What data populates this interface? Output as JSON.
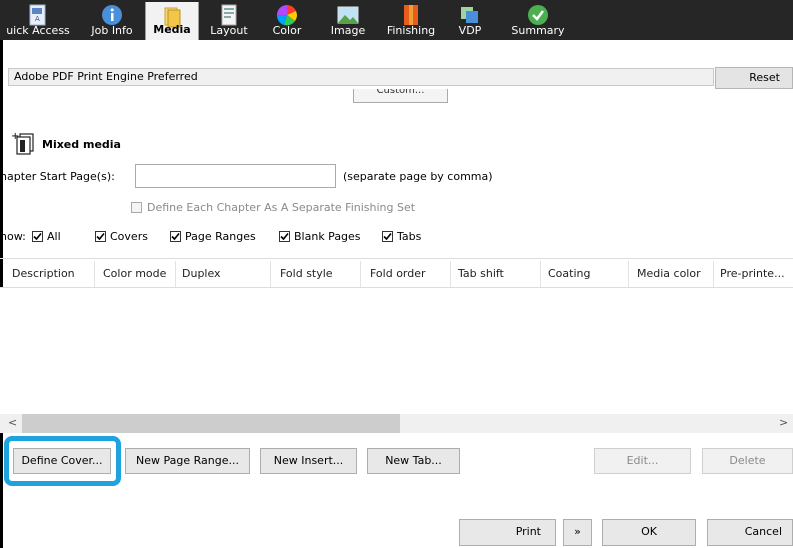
{
  "toolbar": {
    "tabs": [
      {
        "label": "uick Access",
        "icon": "quick-access-icon"
      },
      {
        "label": "Job Info",
        "icon": "info-icon"
      },
      {
        "label": "Media",
        "icon": "media-icon"
      },
      {
        "label": "Layout",
        "icon": "layout-icon"
      },
      {
        "label": "Color",
        "icon": "color-wheel-icon"
      },
      {
        "label": "Image",
        "icon": "image-icon"
      },
      {
        "label": "Finishing",
        "icon": "finishing-icon"
      },
      {
        "label": "VDP",
        "icon": "vdp-icon"
      },
      {
        "label": "Summary",
        "icon": "check-icon"
      }
    ],
    "active": "Media"
  },
  "engine": {
    "label": "Adobe PDF Print Engine Preferred",
    "reset_label": "Reset",
    "custom_label": "Custom..."
  },
  "mixed_media": {
    "title": "Mixed media",
    "chapter_label": "hapter Start Page(s):",
    "chapter_value": "",
    "chapter_hint": "(separate page by comma)",
    "define_chapter_label": "Define Each Chapter As A Separate Finishing Set",
    "show_label": "how:",
    "show_options": [
      {
        "label": "All",
        "checked": true
      },
      {
        "label": "Covers",
        "checked": true
      },
      {
        "label": "Page Ranges",
        "checked": true
      },
      {
        "label": "Blank Pages",
        "checked": true
      },
      {
        "label": "Tabs",
        "checked": true
      }
    ]
  },
  "table": {
    "columns": [
      "Description",
      "Color mode",
      "Duplex",
      "Fold style",
      "Fold order",
      "Tab shift",
      "Coating",
      "Media color",
      "Pre-printe..."
    ],
    "rows": []
  },
  "buttons": {
    "define_cover": "Define Cover...",
    "new_page_range": "New Page Range...",
    "new_insert": "New Insert...",
    "new_tab": "New Tab...",
    "edit": "Edit...",
    "delete": "Delete"
  },
  "footer": {
    "print": "Print",
    "more": "»",
    "ok": "OK",
    "cancel": "Cancel"
  },
  "colors": {
    "highlight": "#1fa3e0",
    "toolbar_bg": "#262626"
  }
}
